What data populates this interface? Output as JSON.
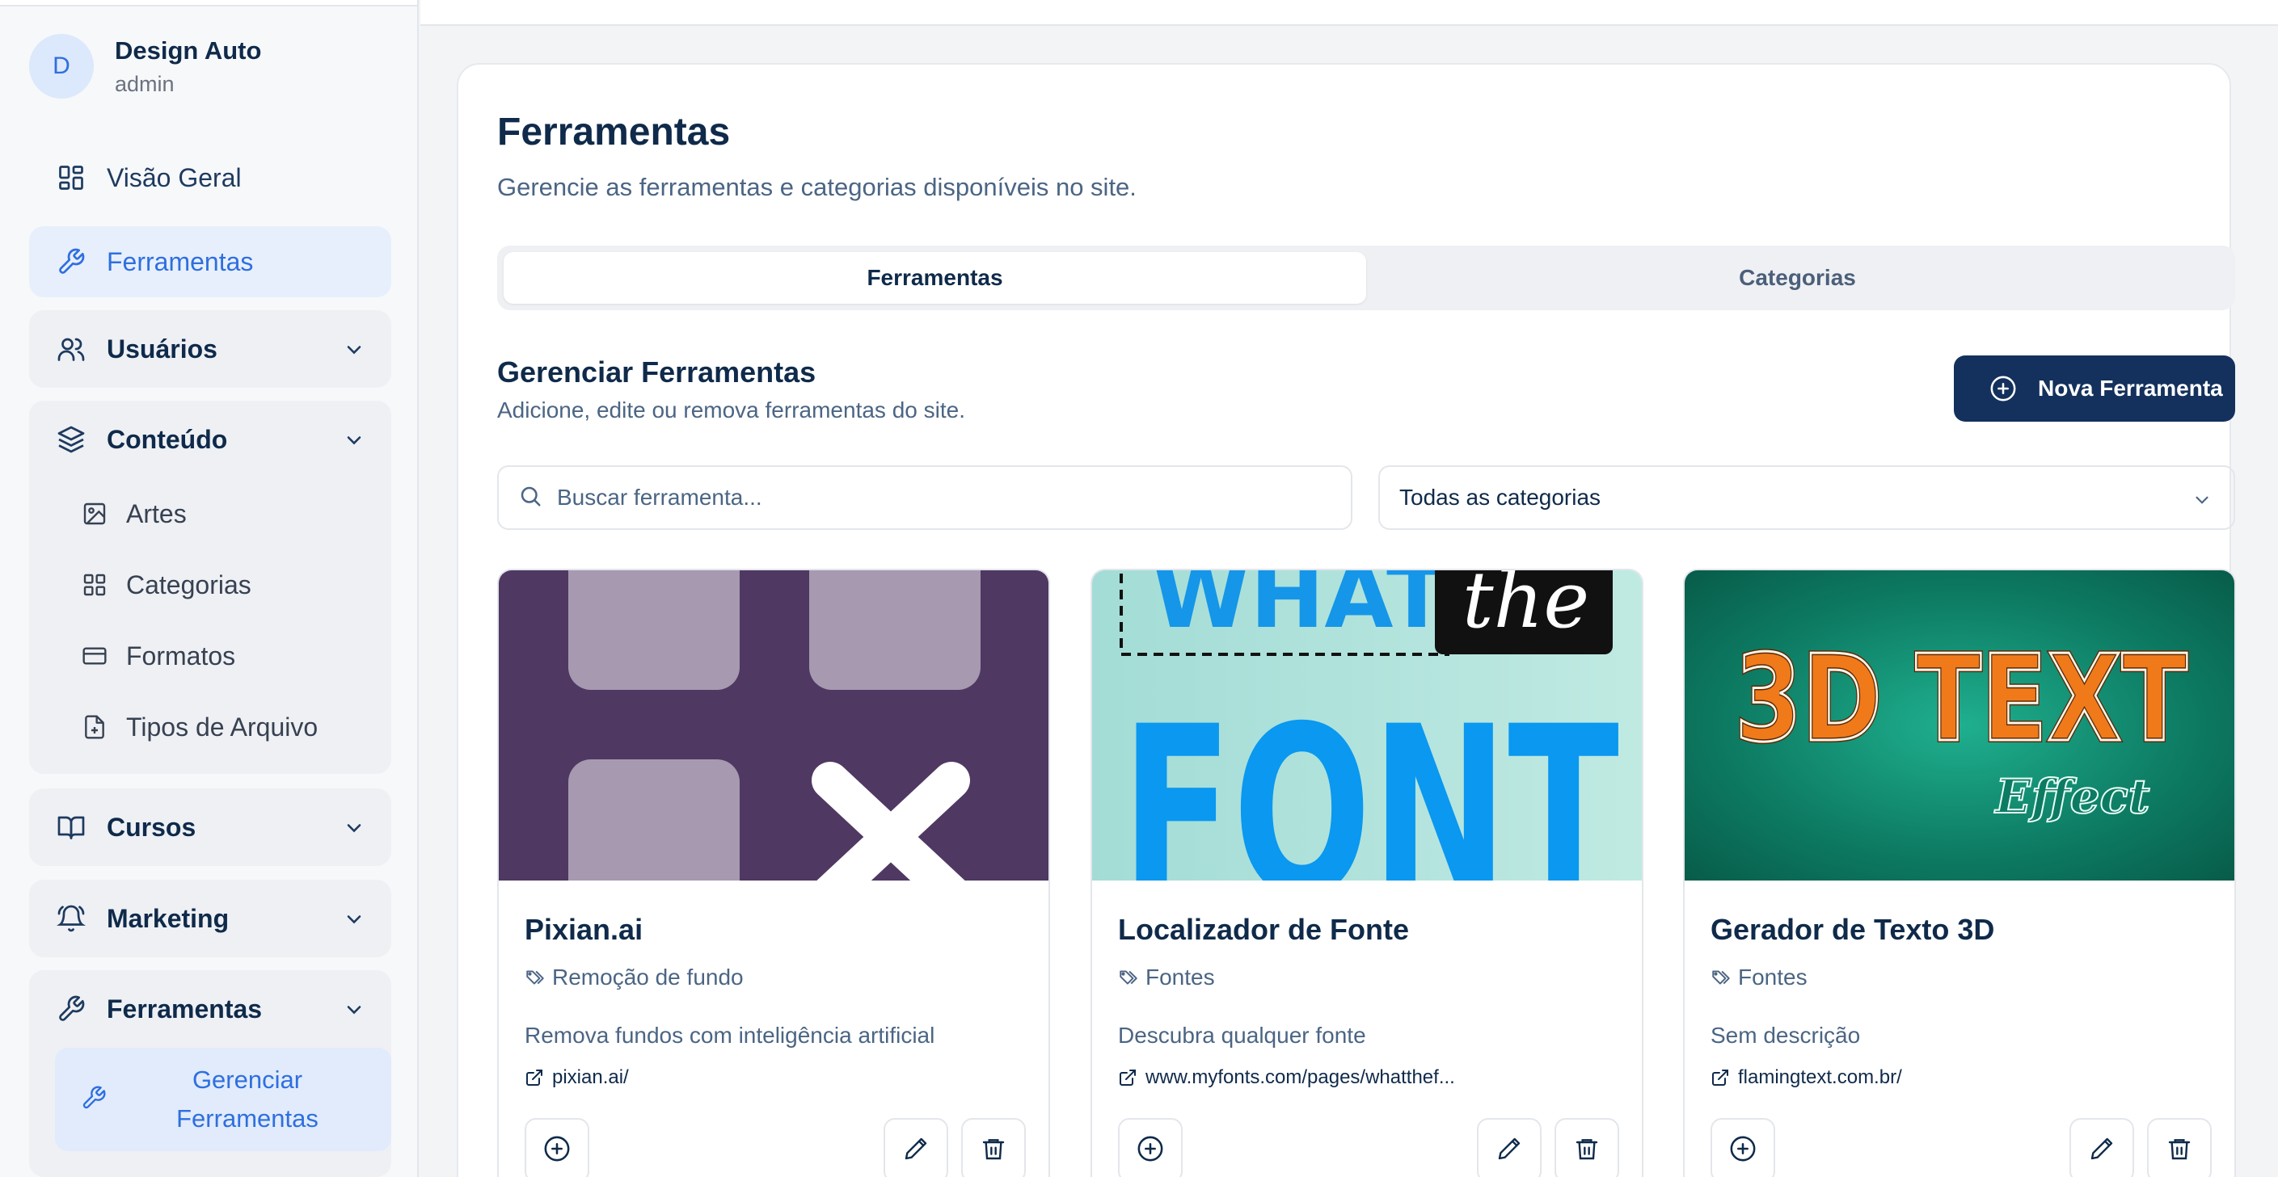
{
  "profile": {
    "initial": "D",
    "name": "Design Auto",
    "role": "admin"
  },
  "nav": {
    "overview": "Visão Geral",
    "tools": "Ferramentas",
    "users": "Usuários",
    "content": {
      "label": "Conteúdo",
      "items": [
        "Artes",
        "Categorias",
        "Formatos",
        "Tipos de Arquivo"
      ]
    },
    "courses": "Cursos",
    "marketing": "Marketing",
    "tools_group": {
      "label": "Ferramentas",
      "active_item": "Gerenciar Ferramentas"
    }
  },
  "page": {
    "title": "Ferramentas",
    "subtitle": "Gerencie as ferramentas e categorias disponíveis no site.",
    "tabs": [
      "Ferramentas",
      "Categorias"
    ],
    "selected_tab": "Ferramentas",
    "section_title": "Gerenciar Ferramentas",
    "section_subtitle": "Adicione, edite ou remova ferramentas do site.",
    "new_button": "Nova Ferramenta",
    "search_placeholder": "Buscar ferramenta...",
    "category_filter": "Todas as categorias"
  },
  "cards": [
    {
      "name": "Pixian.ai",
      "category": "Remoção de fundo",
      "description": "Remova fundos com inteligência artificial",
      "url": "pixian.ai/"
    },
    {
      "name": "Localizador de Fonte",
      "category": "Fontes",
      "description": "Descubra qualquer fonte",
      "url": "www.myfonts.com/pages/whatthef...",
      "thumb_text": [
        "WHAT",
        "the",
        "FONT"
      ]
    },
    {
      "name": "Gerador de Texto 3D",
      "category": "Fontes",
      "description": "Sem descrição",
      "url": "flamingtext.com.br/",
      "thumb_text": [
        "3D TEXT",
        "Effect"
      ]
    }
  ],
  "colors": {
    "accent": "#2f6fdf",
    "primary_button": "#13315c",
    "active_nav_bg": "#e7effc"
  }
}
